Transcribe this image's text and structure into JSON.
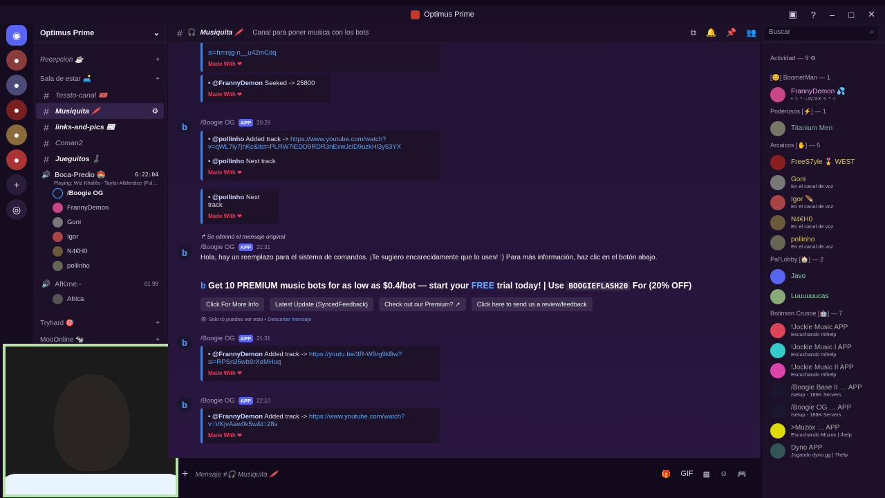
{
  "window": {
    "title": "Optimus Prime"
  },
  "server": {
    "name": "Optimus Prime"
  },
  "categories": {
    "recepcion": "Recepcion ☕",
    "sala": "Sala de estar 🛋️",
    "tryhard": "Tryhard 🎯",
    "moo": "MooOnline 🐄"
  },
  "channels": [
    {
      "name": "Tessto-canal 🎟️"
    },
    {
      "name": "Musiquita 🖍️"
    },
    {
      "name": "links-and-pics 📰"
    },
    {
      "name": "Coman2"
    },
    {
      "name": "Jueguitos ♟️"
    }
  ],
  "voice1": {
    "name": "Boca-Predio 🏟️",
    "time": "6:22:04",
    "activity": "Playing: Wiz Khalifa - Taylor Allderdice (Ful…",
    "users": [
      "/Boogie OG",
      "FrannyDemon",
      "Goni",
      "Igor",
      "N4€H0",
      "pollinho"
    ]
  },
  "voice2": {
    "name": "AfKrne.-",
    "c1": "01",
    "c2": "99",
    "users": [
      "Africa"
    ]
  },
  "header": {
    "channel": "Musiquita 🖍️",
    "topic": "Canal para poner musica con los bots",
    "search": "Buscar"
  },
  "chat": {
    "e1_tail": "si=hmnjg-n__u42mCdq",
    "made": "Made With",
    "e2_user": "@FrannyDemon",
    "e2_text": "Seeked -> 25800",
    "bot_name": "/Boogie OG",
    "app": "APP",
    "t1": "20:29",
    "e3_user": "@pollinho",
    "e3_text": "Added track ->",
    "e3_link": "https://www.youtube.com/watch?v=qWL7ly7jhKc&list=PLRW7iEDD9RDR3nExwJclD9uzkHl3y53YX",
    "e3b_text": "Next track",
    "e4_text": "Next track",
    "deleted": "Se eliminó el mensaje original",
    "t2": "21:31",
    "msg": "Hola, hay un reemplazo para el sistema de comandos. ¡Te sugiero encarecidamente que lo uses! :) Para más información, haz clic en el botón abajo.",
    "promo_a": "Get 10 PREMIUM music bots for as low as $0.4/bot — start your ",
    "promo_free": "FREE",
    "promo_b": " trial today! | Use ",
    "promo_code": "BOOGIEFLASH20",
    "promo_c": " For (20% OFF)",
    "buttons": [
      "Click For More Info",
      "Latest Update (SyncedFeedback)",
      "Check out our Premium? ↗",
      "Click here to send us a review/feedback"
    ],
    "ephemeral": "Solo tú puedes ver esto •",
    "dismiss": "Descartar mensaje",
    "t3": "21:31",
    "e5_user": "@FrannyDemon",
    "e5_text": "Added track ->",
    "e5_link": "https://youtu.be/3R-W9rg9kBw?si=RPSn35wb9rXeMHuq",
    "t4": "22:10",
    "e6_user": "@FrannyDemon",
    "e6_text": "Added track ->",
    "e6_link": "https://www.youtube.com/watch?v=VKjvAaw0k5w&t=28s"
  },
  "composer": {
    "placeholder": "Mensaje #🎧 Musiquita 🖍️"
  },
  "members": {
    "activity": "Actividad — 9 ⚙",
    "groups": [
      {
        "title": "[😊] BoomerMan — 1",
        "items": [
          {
            "name": "FrannyDemon 💦",
            "sub": "• ☆ * ‧₊IV:XX ✧ * ☆"
          }
        ]
      },
      {
        "title": "Poderosos [⚡] — 1",
        "items": [
          {
            "name": "Titanium Men",
            "sub": ""
          }
        ]
      },
      {
        "title": "Arcaicos [✋] — 5",
        "items": [
          {
            "name": "FreeS7yle 🎖️ WEST",
            "sub": ""
          },
          {
            "name": "Goni",
            "sub": "En el canal de voz"
          },
          {
            "name": "Igor 🪶",
            "sub": "En el canal de voz"
          },
          {
            "name": "N4€H0",
            "sub": "En el canal de voz"
          },
          {
            "name": "pollinho",
            "sub": "En el canal de voz"
          }
        ]
      },
      {
        "title": "Pal'Lobby [🏠] — 2",
        "items": [
          {
            "name": "Javo",
            "sub": ""
          },
          {
            "name": "Luuuuuucas",
            "sub": ""
          }
        ]
      },
      {
        "title": "Botinson Crusoe [🤖] — 7",
        "items": [
          {
            "name": "!Jockie Music APP",
            "sub": "Escuchando mlhelp"
          },
          {
            "name": "!Jockie Music I APP",
            "sub": "Escuchando mlhelp"
          },
          {
            "name": "!Jockie Music II APP",
            "sub": "Escuchando mlhelp"
          },
          {
            "name": "/Boogie Base II … APP",
            "sub": "/setup - 186K Servers"
          },
          {
            "name": "/Boogie OG … APP",
            "sub": "/setup - 186K Servers"
          },
          {
            "name": ">Muzox … APP",
            "sub": "Escuchando Muzox | /help"
          },
          {
            "name": "Dyno APP",
            "sub": "Jugando dyno.gg | ?help"
          }
        ]
      }
    ]
  }
}
